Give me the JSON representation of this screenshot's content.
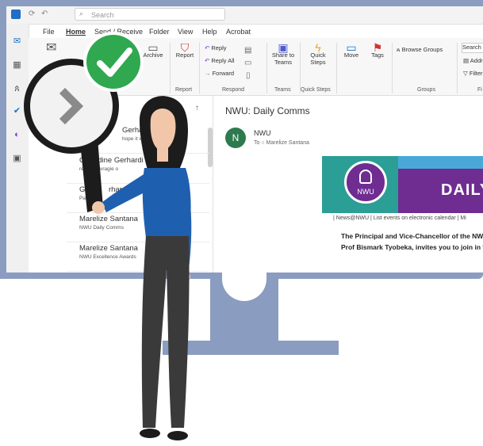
{
  "search": {
    "placeholder": "Search"
  },
  "menu": [
    "File",
    "Home",
    "Send / Receive",
    "Folder",
    "View",
    "Help",
    "Acrobat"
  ],
  "ribbon": {
    "archive": "Archive",
    "report": "Report",
    "reply": "Reply",
    "reply_all": "Reply All",
    "forward": "Forward",
    "share_to_teams": "Share to Teams",
    "quick_steps": "Quick Steps",
    "move": "Move",
    "tags": "Tags",
    "browse_groups": "Browse Groups",
    "search_people": "Search Pe",
    "address": "Addr",
    "filter": "Filter",
    "groups": {
      "report": "Report",
      "respond": "Respond",
      "teams": "Teams",
      "quick_steps": "Quick Steps",
      "groups": "Groups",
      "find": "Fi"
    }
  },
  "maillist": [
    {
      "name": "Gerhardi",
      "subject": "hope it works"
    },
    {
      "name": "Geraldine Gerhardi",
      "subject": "reply: Navragie o"
    },
    {
      "name": "Ger        rhardi",
      "subject": "Passe"
    },
    {
      "name": "Marelize Santana",
      "subject": "NWU Daily Comms"
    },
    {
      "name": "Marelize Santana",
      "subject": "NWU Excellence Awards"
    }
  ],
  "reading": {
    "subject": "NWU: Daily Comms",
    "avatar": "N",
    "sender": "NWU",
    "to": "To  ○ Marelize Santana",
    "banner_logo": "NWU",
    "banner_title": "DAILY",
    "links": "| News@NWU | List events on electronic calendar | Mi",
    "body_line1": "The Principal and Vice-Chancellor of the NW",
    "body_line2": "Prof Bismark Tyobeka, invites you to join in t"
  },
  "colors": {
    "monitor": "#8a9cc0",
    "check_green": "#2fa84f",
    "banner_teal": "#2b9e96",
    "banner_purple": "#6f2c91"
  }
}
